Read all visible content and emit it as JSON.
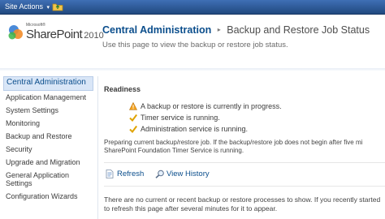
{
  "topbar": {
    "site_actions_label": "Site Actions",
    "caret_icon": "chevron-down-icon",
    "nav_icon": "navigate-up-folder-icon"
  },
  "header": {
    "logo_small": "Microsoft®",
    "logo_main": "SharePoint",
    "logo_year": "2010",
    "site_title": "Central Administration",
    "separator": "▸",
    "page_title": "Backup and Restore Job Status",
    "description": "Use this page to view the backup or restore job status."
  },
  "leftnav": {
    "items": [
      {
        "label": "Central Administration"
      },
      {
        "label": "Application Management"
      },
      {
        "label": "System Settings"
      },
      {
        "label": "Monitoring"
      },
      {
        "label": "Backup and Restore"
      },
      {
        "label": "Security"
      },
      {
        "label": "Upgrade and Migration"
      },
      {
        "label": "General Application Settings"
      },
      {
        "label": "Configuration Wizards"
      }
    ]
  },
  "main": {
    "readiness_heading": "Readiness",
    "statuses": [
      {
        "icon": "warning-icon",
        "text": "A backup or restore is currently in progress."
      },
      {
        "icon": "checkmark-icon",
        "text": "Timer service is running."
      },
      {
        "icon": "checkmark-icon",
        "text": "Administration service is running."
      }
    ],
    "note_line1": "Preparing current backup/restore job. If the backup/restore job does not begin after five mi",
    "note_line2": "SharePoint Foundation Timer Service is running.",
    "refresh_label": "Refresh",
    "view_history_label": "View History",
    "empty_line1": "There are no current or recent backup or restore processes to show. If you recently started",
    "empty_line2": "to refresh this page after several minutes for it to appear."
  },
  "colors": {
    "topbar": "#2d5a9a",
    "link": "#0b4e8c",
    "selected_nav_bg": "#d9e6f7"
  }
}
